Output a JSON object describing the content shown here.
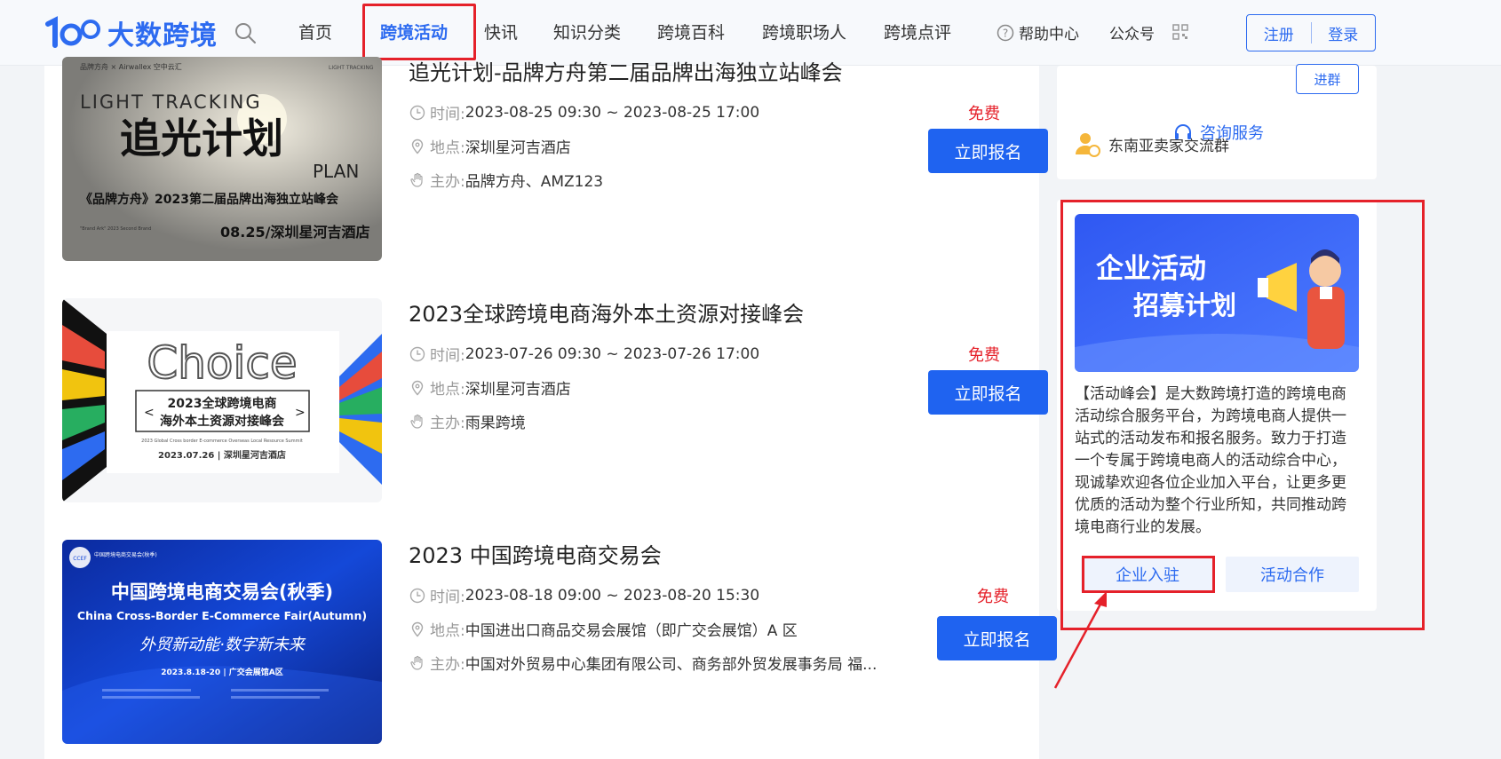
{
  "header": {
    "logo_text": "大数跨境",
    "logo_mark": "100",
    "nav": [
      "首页",
      "跨境活动",
      "快讯",
      "知识分类",
      "跨境百科",
      "跨境职场人",
      "跨境点评"
    ],
    "active_nav": "跨境活动",
    "help": "帮助中心",
    "official_account": "公众号",
    "register": "注册",
    "login": "登录",
    "accent_color": "#2d6bf0"
  },
  "events": [
    {
      "title": "追光计划-品牌方舟第二届品牌出海独立站峰会",
      "time_label": "时间:",
      "time": "2023-08-25 09:30 ~ 2023-08-25 17:00",
      "place_label": "地点:",
      "place": "深圳星河吉酒店",
      "host_label": "主办:",
      "host": "品牌方舟、AMZ123",
      "price": "免费",
      "signup": "立即报名",
      "thumb": {
        "top_left": "品牌方舟 × Airwallex 空中云汇",
        "top_right": "LIGHT TRACKING PLAN",
        "en_line1": "LIGHT TRACKING",
        "cn_title": "追光计划",
        "en_line2": "PLAN",
        "subtitle": "《品牌方舟》2023第二届品牌出海独立站峰会",
        "small": "\"Brand Ark\" 2023 Second Brand Overseas Independent Station Summit",
        "date_place": "08.25/深圳星河吉酒店"
      }
    },
    {
      "title": "2023全球跨境电商海外本土资源对接峰会",
      "time_label": "时间:",
      "time": "2023-07-26 09:30 ~ 2023-07-26 17:00",
      "place_label": "地点:",
      "place": "深圳星河吉酒店",
      "host_label": "主办:",
      "host": "雨果跨境",
      "price": "免费",
      "signup": "立即报名",
      "thumb": {
        "word": "Choice",
        "title1": "2023全球跨境电商",
        "title2": "海外本土资源对接峰会",
        "en": "2023 Global Cross border E-commerce Overseas Local Resource Summit",
        "date_place": "2023.07.26 | 深圳星河吉酒店"
      }
    },
    {
      "title": "2023 中国跨境电商交易会",
      "time_label": "时间:",
      "time": "2023-08-18 09:00 ~ 2023-08-20 15:30",
      "place_label": "地点:",
      "place": "中国进出口商品交易会展馆（即广交会展馆）A 区",
      "host_label": "主办:",
      "host": "中国对外贸易中心集团有限公司、商务部外贸发展事务局 福...",
      "price": "免费",
      "signup": "立即报名",
      "thumb": {
        "badge": "CCEF",
        "top": "中国跨境电商交易会(秋季)",
        "cn_title": "中国跨境电商交易会(秋季)",
        "en_title": "China Cross-Border E-Commerce Fair(Autumn)",
        "slogan": "外贸新动能·数字新未来",
        "date_place": "2023.8.18-20 | 广交会展馆A区"
      }
    }
  ],
  "sidebar": {
    "group_name": "东南亚卖家交流群",
    "join": "进群",
    "consult": "咨询服务",
    "banner_line1": "企业活动",
    "banner_line2": "招募计划",
    "intro": "【活动峰会】是大数跨境打造的跨境电商活动综合服务平台，为跨境电商人提供一站式的活动发布和报名服务。致力于打造一个专属于跨境电商人的活动综合中心，现诚挚欢迎各位企业加入平台，让更多更优质的活动为整个行业所知，共同推动跨境电商行业的发展。",
    "btn_enter": "企业入驻",
    "btn_coop": "活动合作"
  }
}
